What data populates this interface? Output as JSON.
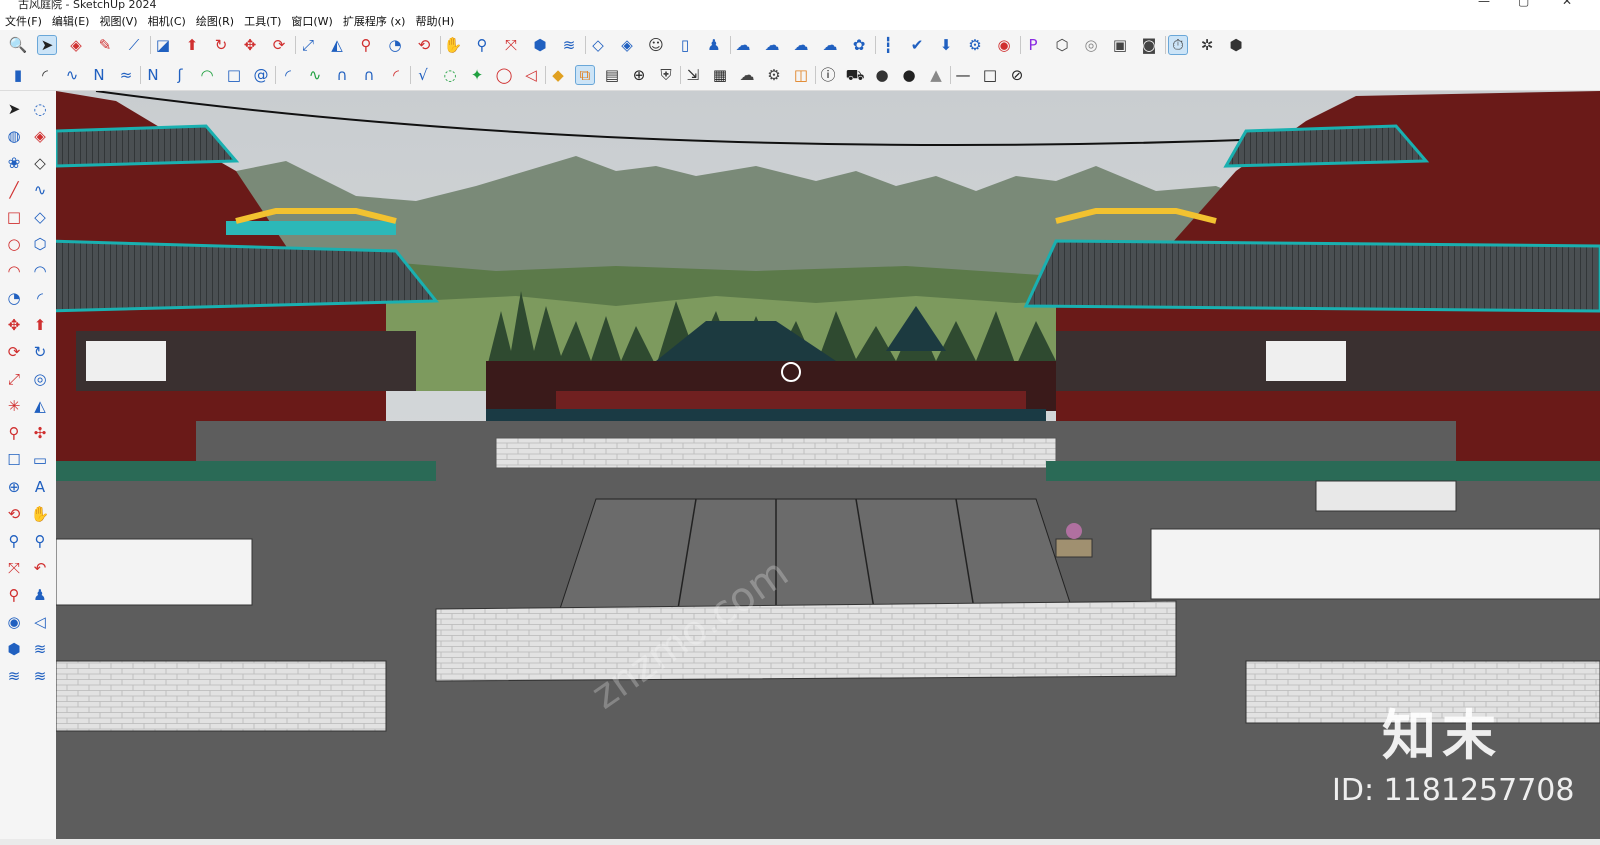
{
  "window": {
    "title": "古风庭院 - SketchUp 2024"
  },
  "menu": [
    "文件(F)",
    "编辑(E)",
    "视图(V)",
    "相机(C)",
    "绘图(R)",
    "工具(T)",
    "窗口(W)",
    "扩展程序 (x)",
    "帮助(H)"
  ],
  "toolbar1": [
    {
      "icon": "zoom-icon",
      "g": "🔍",
      "c": "#333"
    },
    {
      "icon": "select-icon",
      "g": "➤",
      "c": "#222",
      "sel": true
    },
    {
      "icon": "eraser-icon",
      "g": "◈",
      "c": "#d03030"
    },
    {
      "icon": "pencil-icon",
      "g": "✎",
      "c": "#d03030"
    },
    {
      "icon": "polyline-icon",
      "g": "⟋",
      "c": "#2060c0"
    },
    {
      "icon": "rectangle-icon",
      "g": "◪",
      "c": "#2060c0"
    },
    {
      "icon": "pushpull-icon",
      "g": "⬆",
      "c": "#d03030"
    },
    {
      "icon": "followme-icon",
      "g": "↻",
      "c": "#d03030"
    },
    {
      "icon": "move-icon",
      "g": "✥",
      "c": "#d03030"
    },
    {
      "icon": "rotate-icon",
      "g": "⟳",
      "c": "#d03030"
    },
    {
      "icon": "scale-icon",
      "g": "⤢",
      "c": "#2060c0"
    },
    {
      "icon": "offset-icon",
      "g": "◭",
      "c": "#2060c0"
    },
    {
      "icon": "tape-icon",
      "g": "⚲",
      "c": "#d03030"
    },
    {
      "icon": "protractor-icon",
      "g": "◔",
      "c": "#2060c0"
    },
    {
      "icon": "orbit-icon",
      "g": "⟲",
      "c": "#d03030"
    },
    {
      "icon": "pan-icon",
      "g": "✋",
      "c": "#d03030"
    },
    {
      "icon": "zoom-tool-icon",
      "g": "⚲",
      "c": "#2060c0"
    },
    {
      "icon": "zoom-extents-icon",
      "g": "⤧",
      "c": "#d03030"
    },
    {
      "icon": "section-icon",
      "g": "⬢",
      "c": "#2060c0"
    },
    {
      "icon": "layers-icon",
      "g": "≋",
      "c": "#2060c0"
    },
    {
      "icon": "tags-icon",
      "g": "◇",
      "c": "#2060c0"
    },
    {
      "icon": "styles-icon",
      "g": "◈",
      "c": "#2060c0"
    },
    {
      "icon": "user-icon",
      "g": "☺",
      "c": "#333"
    },
    {
      "icon": "new-file-icon",
      "g": "▯",
      "c": "#2060c0"
    },
    {
      "icon": "person-icon",
      "g": "♟",
      "c": "#2060c0"
    },
    {
      "icon": "cloud-icon",
      "g": "☁",
      "c": "#2060c0"
    },
    {
      "icon": "cloud-search-icon",
      "g": "☁",
      "c": "#2060c0"
    },
    {
      "icon": "cloud-upload-icon",
      "g": "☁",
      "c": "#2060c0"
    },
    {
      "icon": "cloud-sync-icon",
      "g": "☁",
      "c": "#2060c0"
    },
    {
      "icon": "component-icon",
      "g": "✿",
      "c": "#2060c0"
    },
    {
      "icon": "bars-icon",
      "g": "┇",
      "c": "#2060c0"
    },
    {
      "icon": "check-icon",
      "g": "✔",
      "c": "#2060c0"
    },
    {
      "icon": "download-icon",
      "g": "⬇",
      "c": "#2060c0"
    },
    {
      "icon": "gear-icon",
      "g": "⚙",
      "c": "#2060c0"
    },
    {
      "icon": "chrome-icon",
      "g": "◉",
      "c": "#d03030"
    },
    {
      "icon": "p-badge-icon",
      "g": "P",
      "c": "#8a2be2"
    },
    {
      "icon": "box-icon",
      "g": "⬡",
      "c": "#444"
    },
    {
      "icon": "target-icon",
      "g": "◎",
      "c": "#888"
    },
    {
      "icon": "camera-icon",
      "g": "▣",
      "c": "#444"
    },
    {
      "icon": "snapshot-icon",
      "g": "◙",
      "c": "#444"
    },
    {
      "icon": "timer-icon",
      "g": "⏱",
      "c": "#444",
      "sel": true
    },
    {
      "icon": "cog-icon",
      "g": "✲",
      "c": "#333"
    },
    {
      "icon": "cube-icon",
      "g": "⬢",
      "c": "#333"
    }
  ],
  "toolbar2": [
    {
      "icon": "book-icon",
      "g": "▮",
      "c": "#2060c0"
    },
    {
      "icon": "arc-icon",
      "g": "◜",
      "c": "#333"
    },
    {
      "icon": "curve-a-icon",
      "g": "∿",
      "c": "#2060c0"
    },
    {
      "icon": "curve-b-icon",
      "g": "N",
      "c": "#2060c0"
    },
    {
      "icon": "curve-c-icon",
      "g": "≈",
      "c": "#2060c0"
    },
    {
      "icon": "curve-d-icon",
      "g": "N",
      "c": "#2060c0"
    },
    {
      "icon": "curve-e-icon",
      "g": "ʃ",
      "c": "#2060c0"
    },
    {
      "icon": "curve-f-icon",
      "g": "◠",
      "c": "#20a040"
    },
    {
      "icon": "square-icon",
      "g": "□",
      "c": "#2060c0"
    },
    {
      "icon": "spiral-icon",
      "g": "@",
      "c": "#2060c0"
    },
    {
      "icon": "curve-g-icon",
      "g": "◜",
      "c": "#2060c0"
    },
    {
      "icon": "curve-h-icon",
      "g": "∿",
      "c": "#20a040"
    },
    {
      "icon": "curve-i-icon",
      "g": "∩",
      "c": "#2060c0"
    },
    {
      "icon": "curve-j-icon",
      "g": "∩",
      "c": "#2060c0"
    },
    {
      "icon": "curve-k-icon",
      "g": "◜",
      "c": "#d03030"
    },
    {
      "icon": "curve-l-icon",
      "g": "√",
      "c": "#2060c0"
    },
    {
      "icon": "circle-dots-icon",
      "g": "◌",
      "c": "#20a040"
    },
    {
      "icon": "wrench-icon",
      "g": "✦",
      "c": "#20a040"
    },
    {
      "icon": "ellipse-icon",
      "g": "◯",
      "c": "#d03030"
    },
    {
      "icon": "triangle-icon",
      "g": "◁",
      "c": "#d03030"
    },
    {
      "icon": "paint-icon",
      "g": "◆",
      "c": "#e0a020"
    },
    {
      "icon": "copy-icon",
      "g": "⧉",
      "c": "#e08020",
      "sel": true
    },
    {
      "icon": "film-icon",
      "g": "▤",
      "c": "#333"
    },
    {
      "icon": "plus-circle-icon",
      "g": "⊕",
      "c": "#222"
    },
    {
      "icon": "shield-icon",
      "g": "⛨",
      "c": "#444"
    },
    {
      "icon": "export-icon",
      "g": "⇲",
      "c": "#333"
    },
    {
      "icon": "checker-icon",
      "g": "▦",
      "c": "#222"
    },
    {
      "icon": "cloud-up-icon",
      "g": "☁",
      "c": "#444"
    },
    {
      "icon": "gears-icon",
      "g": "⚙",
      "c": "#444"
    },
    {
      "icon": "window-icon",
      "g": "◫",
      "c": "#e08020"
    },
    {
      "icon": "info-icon",
      "g": "ⓘ",
      "c": "#222"
    },
    {
      "icon": "cart-icon",
      "g": "⛟",
      "c": "#222"
    },
    {
      "icon": "account-icon",
      "g": "●",
      "c": "#333"
    },
    {
      "icon": "dot-icon",
      "g": "●",
      "c": "#222"
    },
    {
      "icon": "cone-icon",
      "g": "▲",
      "c": "#888"
    },
    {
      "icon": "line-icon",
      "g": "—",
      "c": "#222"
    },
    {
      "icon": "box-outline-icon",
      "g": "□",
      "c": "#222"
    },
    {
      "icon": "hide-icon",
      "g": "⊘",
      "c": "#222"
    }
  ],
  "lefttools": [
    [
      "select-tool-icon",
      "➤",
      "#222"
    ],
    [
      "lasso-icon",
      "◌",
      "#2060c0"
    ],
    [
      "paint-bucket-icon",
      "◍",
      "#2060c0"
    ],
    [
      "eraser-tool-icon",
      "◈",
      "#d03030"
    ],
    [
      "component-tool-icon",
      "❀",
      "#2060c0"
    ],
    [
      "tag-icon",
      "◇",
      "#333"
    ],
    [
      "line-tool-icon",
      "╱",
      "#d03030"
    ],
    [
      "freehand-icon",
      "∿",
      "#2060c0"
    ],
    [
      "rect-tool-icon",
      "□",
      "#d03030"
    ],
    [
      "rotated-rect-icon",
      "◇",
      "#2060c0"
    ],
    [
      "circle-tool-icon",
      "○",
      "#d03030"
    ],
    [
      "polygon-tool-icon",
      "⬡",
      "#2060c0"
    ],
    [
      "arc-tool-icon",
      "◠",
      "#d03030"
    ],
    [
      "arc2-tool-icon",
      "◠",
      "#2060c0"
    ],
    [
      "pie-tool-icon",
      "◔",
      "#2060c0"
    ],
    [
      "arc3-tool-icon",
      "◜",
      "#2060c0"
    ],
    [
      "move-tool-icon",
      "✥",
      "#d03030"
    ],
    [
      "pushpull-tool-icon",
      "⬆",
      "#d03030"
    ],
    [
      "rotate-tool-icon",
      "⟳",
      "#d03030"
    ],
    [
      "followme-tool-icon",
      "↻",
      "#2060c0"
    ],
    [
      "scale-tool-icon",
      "⤢",
      "#d03030"
    ],
    [
      "offset-tool-icon",
      "◎",
      "#2060c0"
    ],
    [
      "axes-tool-icon",
      "✳",
      "#d03030"
    ],
    [
      "protractor-tool-icon",
      "◭",
      "#2060c0"
    ],
    [
      "tape-tool-icon",
      "⚲",
      "#d03030"
    ],
    [
      "dimension-tool-icon",
      "✣",
      "#d03030"
    ],
    [
      "text-tool-icon",
      "☐",
      "#2060c0"
    ],
    [
      "label-tool-icon",
      "▭",
      "#2060c0"
    ],
    [
      "axis-tool-icon",
      "⊕",
      "#2060c0"
    ],
    [
      "3dtext-tool-icon",
      "A",
      "#2060c0"
    ],
    [
      "orbit-tool-icon",
      "⟲",
      "#d03030"
    ],
    [
      "pan-tool-icon",
      "✋",
      "#d03030"
    ],
    [
      "zoom-tool-icon2",
      "⚲",
      "#2060c0"
    ],
    [
      "zoom-window-icon",
      "⚲",
      "#2060c0"
    ],
    [
      "zoom-extents-tool-icon",
      "⤧",
      "#d03030"
    ],
    [
      "previous-view-icon",
      "↶",
      "#d03030"
    ],
    [
      "position-camera-icon",
      "⚲",
      "#d03030"
    ],
    [
      "walk-icon",
      "♟",
      "#2060c0"
    ],
    [
      "look-around-icon",
      "◉",
      "#2060c0"
    ],
    [
      "section-plane-icon",
      "◁",
      "#2060c0"
    ],
    [
      "display-section-icon",
      "⬢",
      "#2060c0"
    ],
    [
      "section-cuts-icon",
      "≋",
      "#2060c0"
    ],
    [
      "layers-tool-icon",
      "≋",
      "#2060c0"
    ],
    [
      "styles-tool-icon",
      "≋",
      "#2060c0"
    ]
  ],
  "viewport": {
    "label": "3d-viewport"
  },
  "watermark": {
    "brand": "知末",
    "id_text": "ID: 1181257708",
    "site": "znzmo.com"
  }
}
